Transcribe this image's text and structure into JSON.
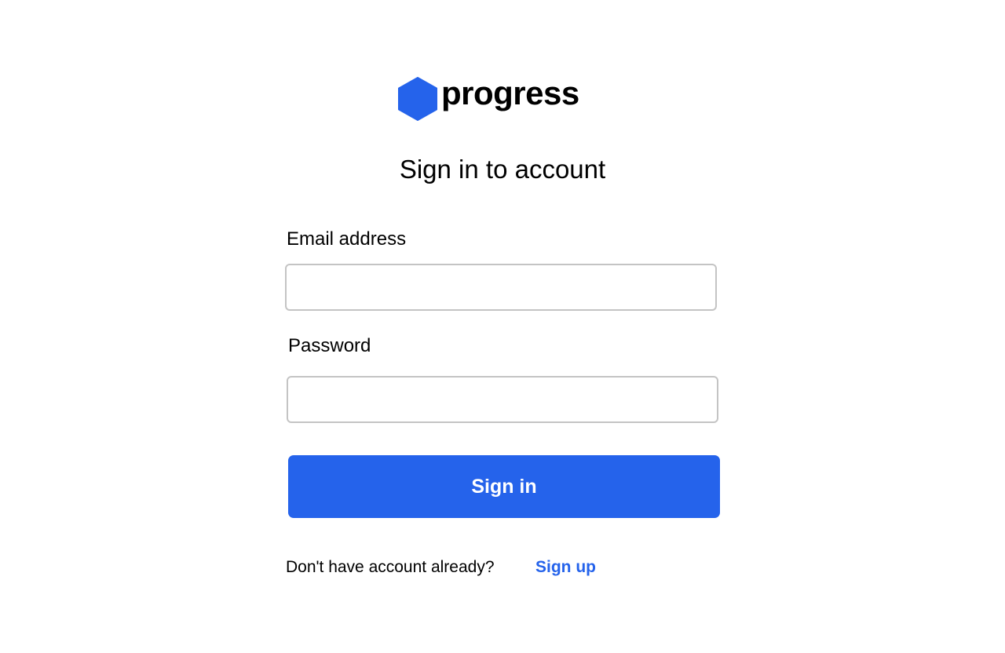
{
  "brand": {
    "name": "progress",
    "logo_icon": "hexagon-logo-icon",
    "accent_color": "#2563eb"
  },
  "page": {
    "title": "Sign in to account"
  },
  "form": {
    "email_label": "Email address",
    "email_value": "",
    "password_label": "Password",
    "password_value": "",
    "submit_label": "Sign in"
  },
  "footer": {
    "prompt": "Don't have account already?",
    "signup_label": "Sign up"
  }
}
